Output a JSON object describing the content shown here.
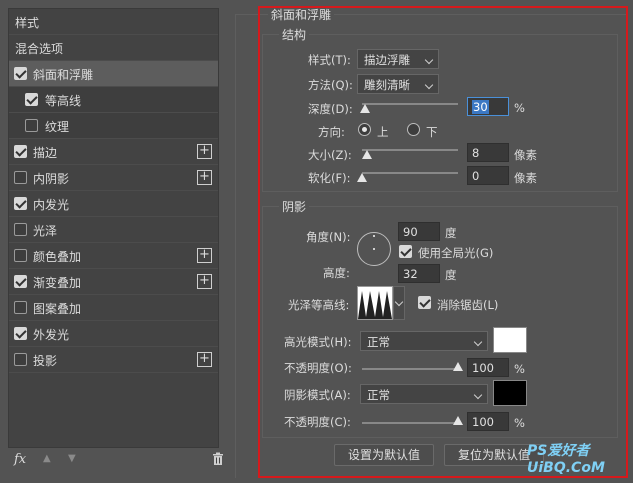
{
  "left_panel": {
    "items": [
      {
        "label": "样式",
        "checkbox": false,
        "checked": false,
        "plus": false
      },
      {
        "label": "混合选项",
        "checkbox": false,
        "checked": false,
        "plus": false
      },
      {
        "label": "斜面和浮雕",
        "checkbox": true,
        "checked": true,
        "plus": false
      },
      {
        "label": "等高线",
        "checkbox": true,
        "checked": true,
        "plus": false
      },
      {
        "label": "纹理",
        "checkbox": true,
        "checked": false,
        "plus": false
      },
      {
        "label": "描边",
        "checkbox": true,
        "checked": true,
        "plus": true
      },
      {
        "label": "内阴影",
        "checkbox": true,
        "checked": false,
        "plus": true
      },
      {
        "label": "内发光",
        "checkbox": true,
        "checked": true,
        "plus": false
      },
      {
        "label": "光泽",
        "checkbox": true,
        "checked": false,
        "plus": false
      },
      {
        "label": "颜色叠加",
        "checkbox": true,
        "checked": false,
        "plus": true
      },
      {
        "label": "渐变叠加",
        "checkbox": true,
        "checked": true,
        "plus": true
      },
      {
        "label": "图案叠加",
        "checkbox": true,
        "checked": false,
        "plus": false
      },
      {
        "label": "外发光",
        "checkbox": true,
        "checked": true,
        "plus": false
      },
      {
        "label": "投影",
        "checkbox": true,
        "checked": false,
        "plus": true
      }
    ],
    "footer": {
      "fx": "fx",
      "up": "▲",
      "down": "▼",
      "trash": "trash-icon"
    }
  },
  "bevel": {
    "title": "斜面和浮雕",
    "structure": {
      "title": "结构",
      "style_label": "样式(T):",
      "style_value": "描边浮雕",
      "technique_label": "方法(Q):",
      "technique_value": "雕刻清晰",
      "depth_label": "深度(D):",
      "depth_value": "30",
      "depth_unit": "%",
      "depth_level": 0.03,
      "direction_label": "方向:",
      "dir_up": "上",
      "dir_down": "下",
      "size_label": "大小(Z):",
      "size_value": "8",
      "size_unit": "像素",
      "size_level": 0.05,
      "soften_label": "软化(F):",
      "soften_value": "0",
      "soften_unit": "像素",
      "soften_level": 0.0
    },
    "shading": {
      "title": "阴影",
      "angle_label": "角度(N):",
      "angle_value": "90",
      "angle_unit": "度",
      "global_light": "使用全局光(G)",
      "altitude_label": "高度:",
      "altitude_value": "32",
      "altitude_unit": "度",
      "gloss_label": "光泽等高线:",
      "antialias": "消除锯齿(L)",
      "highlight_mode_label": "高光模式(H):",
      "highlight_mode_value": "正常",
      "highlight_color": "#ffffff",
      "highlight_opacity_label": "不透明度(O):",
      "highlight_opacity_value": "100",
      "highlight_opacity_unit": "%",
      "highlight_opacity_level": 1.0,
      "shadow_mode_label": "阴影模式(A):",
      "shadow_mode_value": "正常",
      "shadow_color": "#000000",
      "shadow_opacity_label": "不透明度(C):",
      "shadow_opacity_value": "100",
      "shadow_opacity_unit": "%",
      "shadow_opacity_level": 1.0
    },
    "buttons": {
      "default_set": "设置为默认值",
      "default_reset": "复位为默认值"
    }
  },
  "watermark": "PS爱好者 UiBQ.CoM",
  "accent_color": "#d6191c"
}
